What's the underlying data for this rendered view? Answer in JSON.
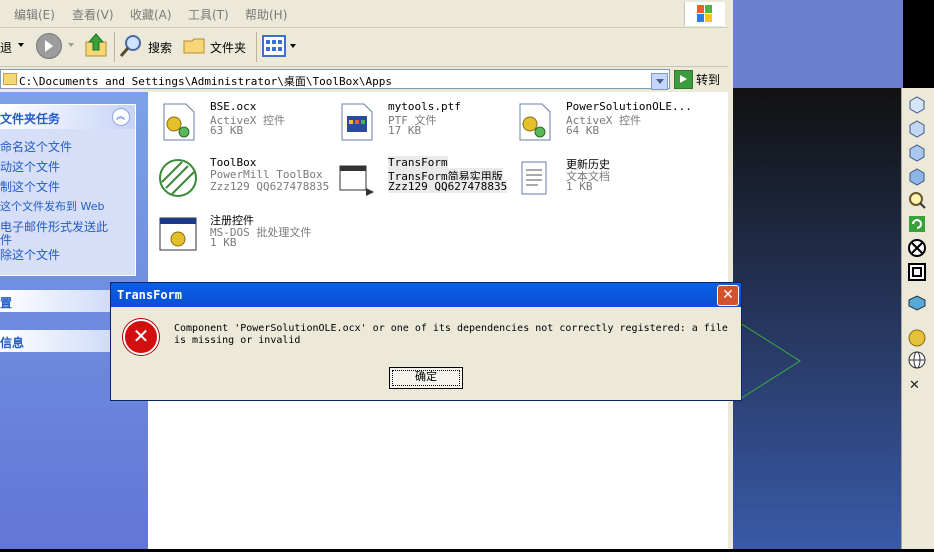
{
  "menu": {
    "items": [
      "编辑(E)",
      "查看(V)",
      "收藏(A)",
      "工具(T)",
      "帮助(H)"
    ]
  },
  "toolbar": {
    "back_label": "退",
    "search_label": "搜索",
    "folders_label": "文件夹"
  },
  "address": {
    "path": "C:\\Documents and Settings\\Administrator\\桌面\\ToolBox\\Apps",
    "go_label": "转到"
  },
  "taskpane": {
    "tasks_title": "文件夹任务",
    "tasks": [
      "命名这个文件",
      "动这个文件",
      "制这个文件",
      "这个文件发布到 Web",
      "电子邮件形式发送此",
      "件",
      "除这个文件"
    ],
    "places_title": "置",
    "details_title": "信息"
  },
  "files": [
    {
      "name": "BSE.ocx",
      "type": "ActiveX 控件",
      "size": "63 KB"
    },
    {
      "name": "mytools.ptf",
      "type": "PTF 文件",
      "size": "17 KB"
    },
    {
      "name": "PowerSolutionOLE...",
      "type": "ActiveX 控件",
      "size": "64 KB"
    },
    {
      "name": "ToolBox",
      "type": "PowerMill ToolBox",
      "size": "Zzz129 QQ627478835"
    },
    {
      "name": "TransForm",
      "type": "TransForm简易实用版",
      "size": "Zzz129 QQ627478835"
    },
    {
      "name": "更新历史",
      "type": "文本文档",
      "size": "1 KB"
    },
    {
      "name": "注册控件",
      "type": "MS-DOS 批处理文件",
      "size": "1 KB"
    }
  ],
  "dialog": {
    "title": "TransForm",
    "message": "Component 'PowerSolutionOLE.ocx' or one of its dependencies not correctly registered: a file is missing or invalid",
    "ok_label": "确定",
    "close_glyph": "✕",
    "error_glyph": "✕"
  },
  "side_tools": {
    "close_glyph": "✕"
  },
  "colors": {
    "titlebar": "#0a5fe5",
    "error": "#d20e0e",
    "link": "#215dc6"
  }
}
